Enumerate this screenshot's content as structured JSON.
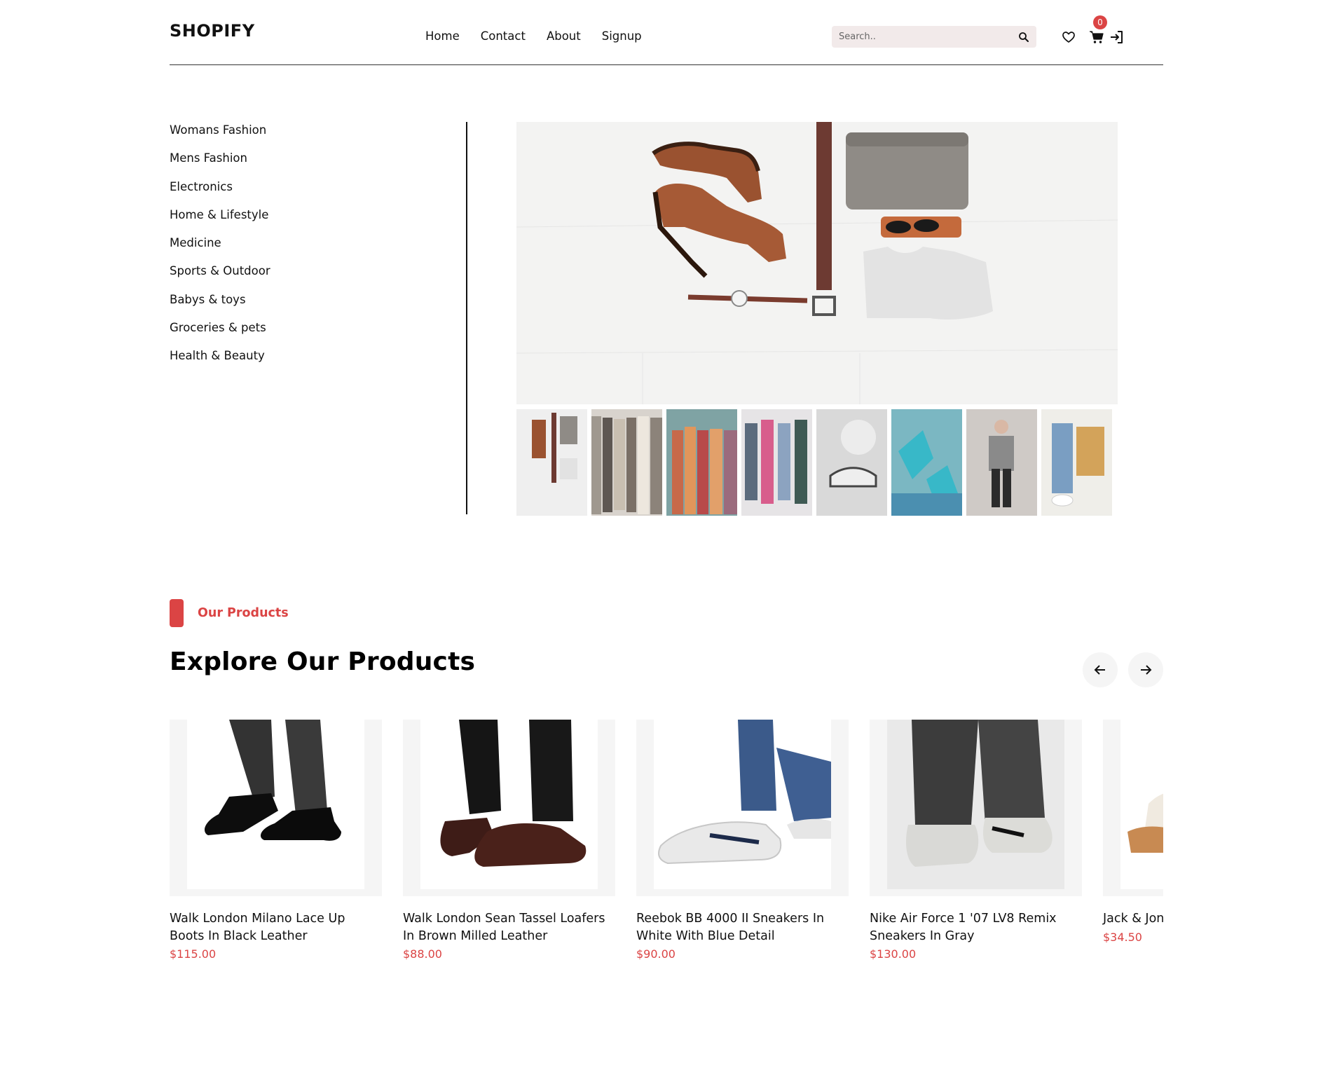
{
  "header": {
    "logo": "SHOPIFY",
    "nav": [
      "Home",
      "Contact",
      "About",
      "Signup"
    ],
    "search_placeholder": "Search..",
    "cart_count": "0"
  },
  "sidebar": {
    "categories": [
      "Womans Fashion",
      "Mens Fashion",
      "Electronics",
      "Home & Lifestyle",
      "Medicine",
      "Sports & Outdoor",
      "Babys & toys",
      "Groceries & pets",
      "Health & Beauty"
    ]
  },
  "hero": {
    "thumbnail_count": 8
  },
  "products_section": {
    "tag": "Our Products",
    "title": "Explore Our Products",
    "items": [
      {
        "name": "Walk London Milano Lace Up Boots In Black Leather",
        "price": "$115.00"
      },
      {
        "name": "Walk London Sean Tassel Loafers In Brown Milled Leather",
        "price": "$88.00"
      },
      {
        "name": "Reebok BB 4000 II Sneakers In White With Blue Detail",
        "price": "$90.00"
      },
      {
        "name": "Nike Air Force 1 '07 LV8 Remix Sneakers In Gray",
        "price": "$130.00"
      },
      {
        "name": "Jack & Jones Slippers In",
        "price": "$34.50"
      }
    ]
  },
  "colors": {
    "accent": "#db4444",
    "search_bg": "#f2eaea",
    "card_bg": "#f5f5f5"
  }
}
